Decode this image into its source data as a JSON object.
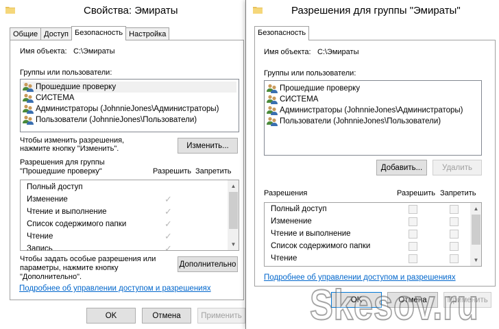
{
  "props_window": {
    "title": "Свойства: Эмираты",
    "tabs": [
      "Общие",
      "Доступ",
      "Безопасность",
      "Настройка"
    ],
    "object_name_label": "Имя объекта:",
    "object_name_value": "C:\\Эмираты",
    "groups_label": "Группы или пользователи:",
    "users": [
      "Прошедшие проверку",
      "СИСТЕМА",
      "Администраторы (JohnnieJones\\Администраторы)",
      "Пользователи (JohnnieJones\\Пользователи)"
    ],
    "change_hint_line1": "Чтобы изменить разрешения,",
    "change_hint_line2": "нажмите кнопку \"Изменить\".",
    "change_button": "Изменить...",
    "perm_for_line1": "Разрешения для группы",
    "perm_for_line2": "\"Прошедшие проверку\"",
    "allow_label": "Разрешить",
    "deny_label": "Запретить",
    "permissions": [
      "Полный доступ",
      "Изменение",
      "Чтение и выполнение",
      "Список содержимого папки",
      "Чтение",
      "Запись"
    ],
    "advanced_hint_line1": "Чтобы задать особые разрешения или",
    "advanced_hint_line2": "параметры, нажмите кнопку",
    "advanced_hint_line3": "\"Дополнительно\".",
    "advanced_button": "Дополнительно",
    "link": "Подробнее об управлении доступом и разрешениях",
    "ok": "OK",
    "cancel": "Отмена",
    "apply": "Применить"
  },
  "perm_dialog": {
    "title": "Разрешения для группы \"Эмираты\"",
    "tab": "Безопасность",
    "object_name_label": "Имя объекта:",
    "object_name_value": "C:\\Эмираты",
    "groups_label": "Группы или пользователи:",
    "users": [
      "Прошедшие проверку",
      "СИСТЕМА",
      "Администраторы (JohnnieJones\\Администраторы)",
      "Пользователи (JohnnieJones\\Пользователи)"
    ],
    "add_button": "Добавить...",
    "remove_button": "Удалить",
    "permissions_label": "Разрешения",
    "allow_label": "Разрешить",
    "deny_label": "Запретить",
    "permissions": [
      "Полный доступ",
      "Изменение",
      "Чтение и выполнение",
      "Список содержимого папки",
      "Чтение"
    ],
    "link": "Подробнее об управлении доступом и разрешениях",
    "ok": "OK",
    "cancel": "Отмена",
    "apply": "Применить"
  },
  "watermark": "Skesov.ru",
  "colors": {
    "link": "#0066cc",
    "focus": "#0078d7",
    "panel_border": "#a0a0a0"
  }
}
